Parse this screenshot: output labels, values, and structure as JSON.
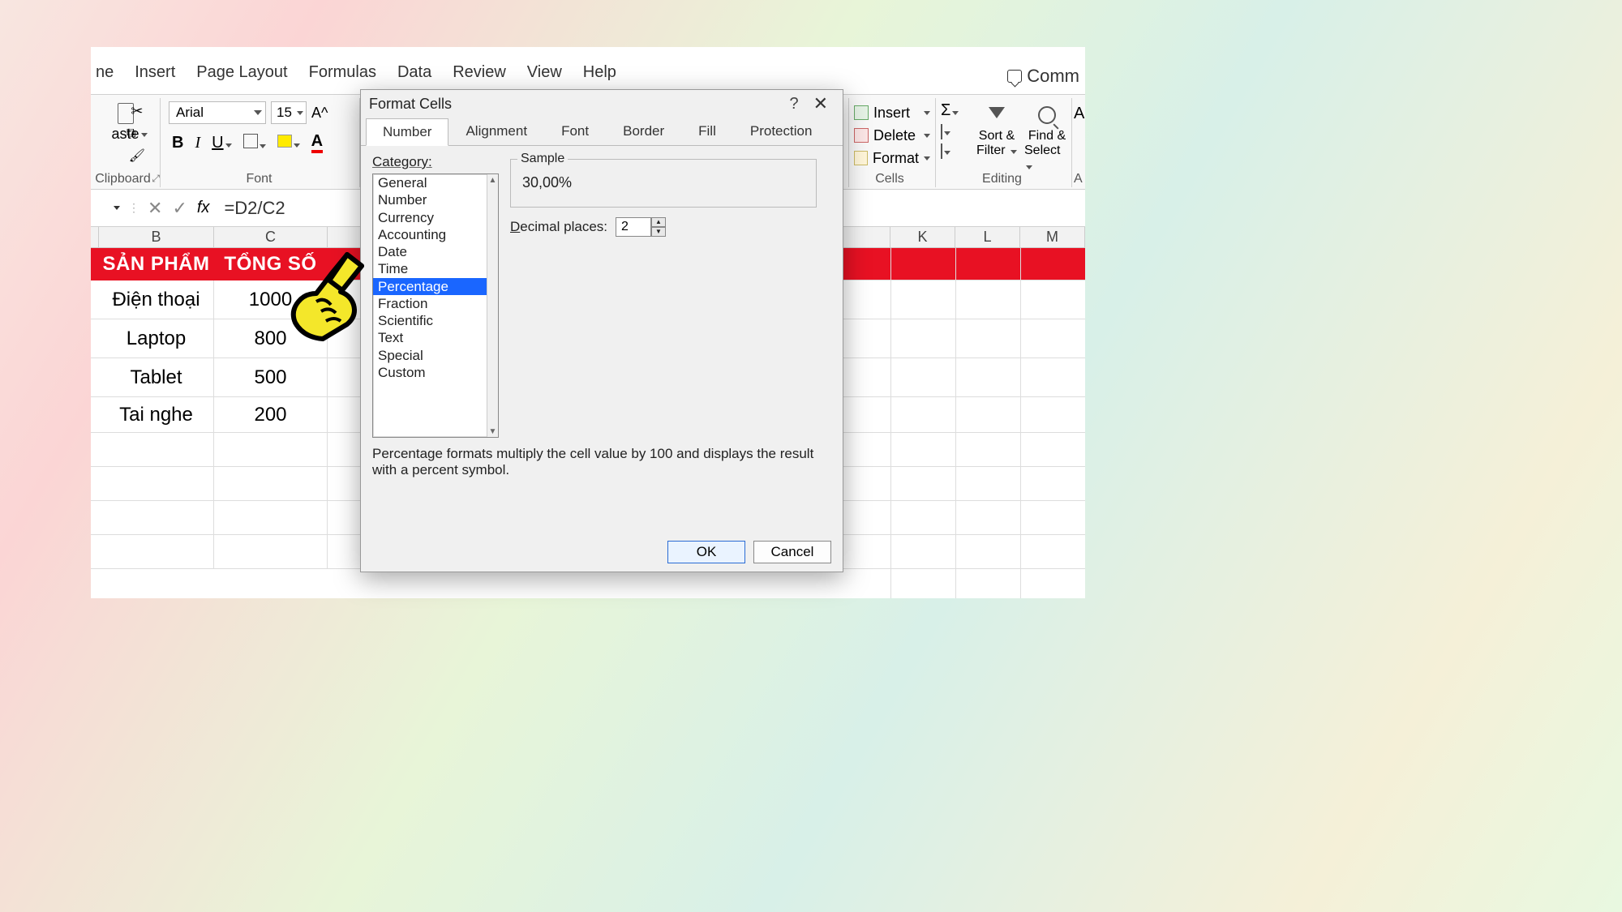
{
  "ribbon": {
    "tabs": [
      "ne",
      "Insert",
      "Page Layout",
      "Formulas",
      "Data",
      "Review",
      "View",
      "Help"
    ],
    "comments": "Comm"
  },
  "toolbar": {
    "paste": "aste",
    "clipboard_label": "Clipboard",
    "font_name": "Arial",
    "font_size": "15",
    "increase_font": "A^",
    "bold": "B",
    "italic": "I",
    "underline": "U",
    "font_color_letter": "A",
    "font_label": "Font",
    "insert": "Insert",
    "delete": "Delete",
    "format": "Format",
    "cells_label": "Cells",
    "sigma": "Σ",
    "sort_line1": "Sort &",
    "sort_line2": "Filter",
    "find_line1": "Find &",
    "find_line2": "Select",
    "editing_label": "Editing",
    "last_letter": "A",
    "last_group": "A"
  },
  "formula_bar": {
    "cancel": "✕",
    "enter": "✓",
    "fx": "fx",
    "formula": "=D2/C2"
  },
  "grid": {
    "cols": {
      "B": "B",
      "C": "C",
      "K": "K",
      "L": "L",
      "M": "M"
    },
    "header": {
      "b": "SẢN PHẨM",
      "c": "TỔNG SỐ"
    },
    "rows": [
      {
        "b": "Điện thoại",
        "c": "1000"
      },
      {
        "b": "Laptop",
        "c": "800"
      },
      {
        "b": "Tablet",
        "c": "500"
      },
      {
        "b": "Tai nghe",
        "c": "200"
      }
    ]
  },
  "dialog": {
    "title": "Format Cells",
    "help": "?",
    "close": "✕",
    "tabs": [
      "Number",
      "Alignment",
      "Font",
      "Border",
      "Fill",
      "Protection"
    ],
    "active_tab": 0,
    "category_label": "Category:",
    "categories": [
      "General",
      "Number",
      "Currency",
      "Accounting",
      "Date",
      "Time",
      "Percentage",
      "Fraction",
      "Scientific",
      "Text",
      "Special",
      "Custom"
    ],
    "selected_category_index": 6,
    "sample_label": "Sample",
    "sample_value": "30,00%",
    "decimal_label": "Decimal places:",
    "decimal_value": "2",
    "description": "Percentage formats multiply the cell value by 100 and displays the result with a percent symbol.",
    "ok": "OK",
    "cancel": "Cancel"
  }
}
